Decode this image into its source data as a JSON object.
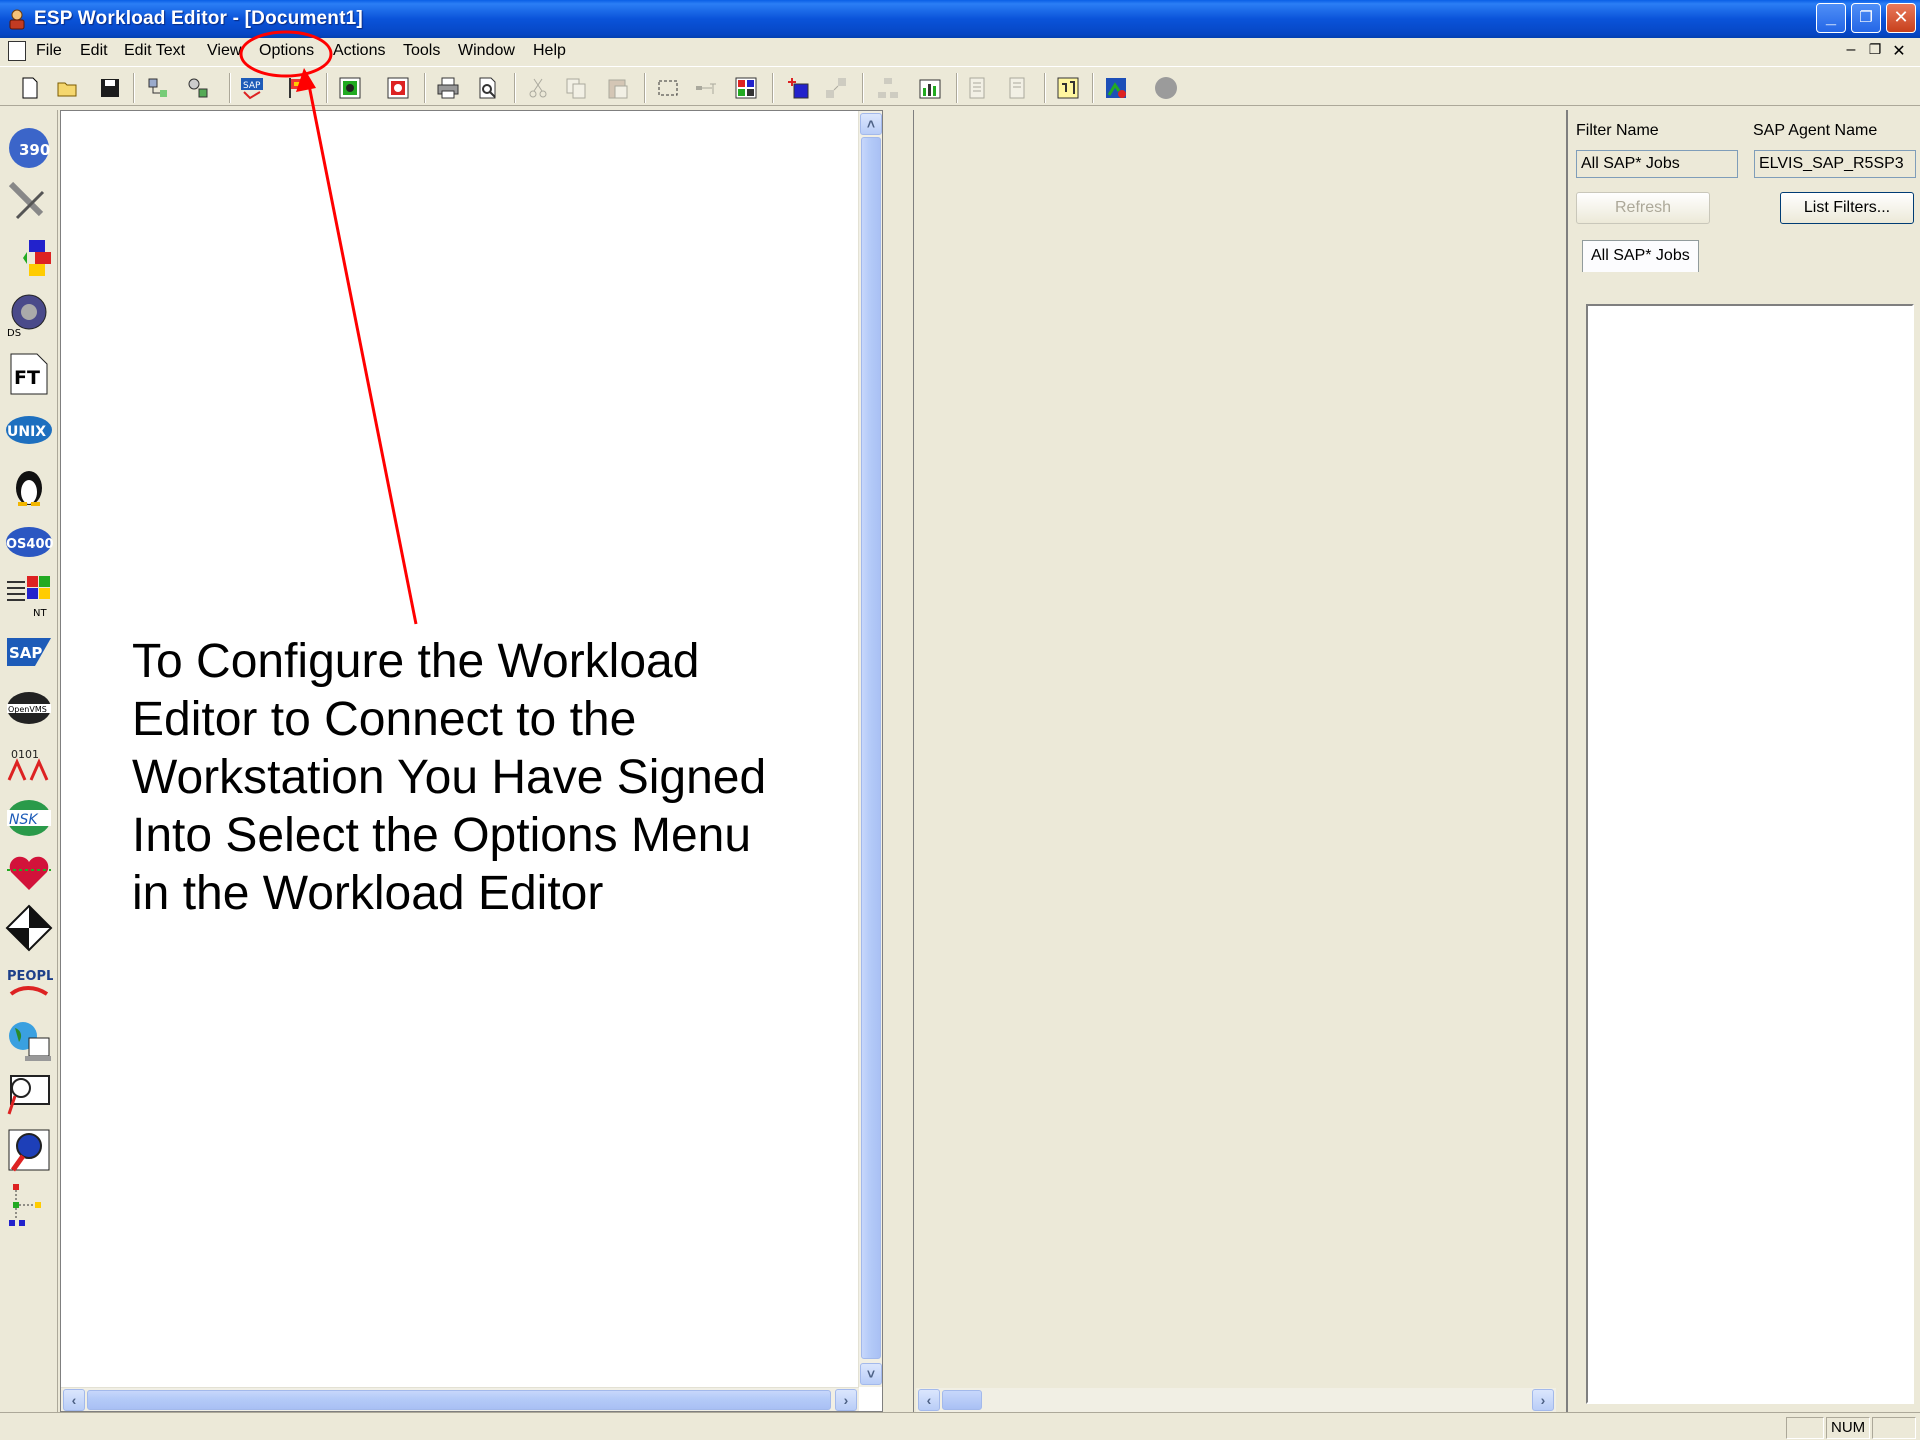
{
  "window": {
    "title": "ESP Workload Editor - [Document1]",
    "minimize": "_",
    "restore": "❐",
    "close": "✕"
  },
  "menubar": {
    "items": [
      "File",
      "Edit",
      "Edit Text",
      "View",
      "Options",
      "Actions",
      "Tools",
      "Window",
      "Help"
    ],
    "mdi_minimize": "–",
    "mdi_restore": "❐",
    "mdi_close": "✕"
  },
  "palette": {
    "icons": [
      "os390-icon",
      "tools-icon",
      "link-icon",
      "ds-icon",
      "ft-icon",
      "unix-icon",
      "linux-icon",
      "os400-icon",
      "nt-icon",
      "sap-icon",
      "openvms-icon",
      "data-icon",
      "nsk-icon",
      "heart-icon",
      "flow-icon",
      "peoplesoft-icon",
      "web-icon",
      "monitor-icon",
      "magnifier-icon",
      "tree-icon"
    ],
    "labels": {
      "os390": "390",
      "ds": "DS",
      "ft": "FT",
      "unix": "UNIX",
      "os400": "OS400",
      "nt": "NT",
      "sap": "SAP",
      "openvms": "OpenVMS",
      "data": "0101",
      "nsk": "NSK",
      "peoplesoft": "PEOPLE"
    }
  },
  "right_panel": {
    "filter_name_label": "Filter Name",
    "filter_name_value": "All SAP* Jobs",
    "agent_name_label": "SAP Agent Name",
    "agent_name_value": "ELVIS_SAP_R5SP3",
    "refresh_label": "Refresh",
    "list_filters_label": "List Filters...",
    "tab_label": "All SAP* Jobs"
  },
  "statusbar": {
    "num": "NUM"
  },
  "annotation": {
    "text_lines": [
      "To Configure the Workload",
      "Editor to Connect to the",
      "Workstation You Have Signed",
      "Into Select the Options Menu",
      "in the Workload Editor"
    ],
    "arrow_color": "#ff0000"
  }
}
